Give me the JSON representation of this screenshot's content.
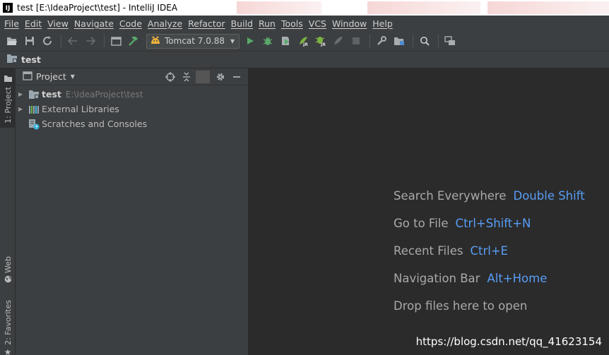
{
  "window": {
    "logo": "IJ",
    "title": "test [E:\\IdeaProject\\test] - IntelliJ IDEA"
  },
  "menu": [
    "File",
    "Edit",
    "View",
    "Navigate",
    "Code",
    "Analyze",
    "Refactor",
    "Build",
    "Run",
    "Tools",
    "VCS",
    "Window",
    "Help"
  ],
  "toolbar": {
    "icons": [
      "open-folder-icon",
      "save-icon",
      "sync-icon",
      "back-arrow-icon",
      "forward-arrow-icon",
      "project-structure-icon",
      "build-hammer-icon"
    ],
    "run_config_label": "Tomcat 7.0.88",
    "run_icons": [
      "run-icon",
      "debug-icon",
      "coverage-icon",
      "jrebel-run-icon",
      "jrebel-debug-icon",
      "profile-icon",
      "stop-icon"
    ],
    "right_icons": [
      "settings-wrench-icon",
      "project-structure-icon",
      "search-icon",
      "sdk-manager-icon"
    ]
  },
  "navbar": {
    "crumb": "test"
  },
  "stripe": {
    "tabs": [
      {
        "label": "1: Project",
        "active": true
      },
      {
        "label": "Web",
        "active": false
      },
      {
        "label": "2: Favorites",
        "active": false
      }
    ]
  },
  "project_panel": {
    "title": "Project",
    "tree": [
      {
        "label": "test",
        "path": "E:\\IdeaProject\\test",
        "icon": "module-folder-icon",
        "bold": true
      },
      {
        "label": "External Libraries",
        "path": "",
        "icon": "libraries-icon",
        "bold": false
      },
      {
        "label": "Scratches and Consoles",
        "path": "",
        "icon": "scratches-icon",
        "bold": false
      }
    ]
  },
  "editor": {
    "hints": [
      {
        "label": "Search Everywhere",
        "key": "Double Shift"
      },
      {
        "label": "Go to File",
        "key": "Ctrl+Shift+N"
      },
      {
        "label": "Recent Files",
        "key": "Ctrl+E"
      },
      {
        "label": "Navigation Bar",
        "key": "Alt+Home"
      },
      {
        "label": "Drop files here to open",
        "key": ""
      }
    ],
    "watermark": "https://blog.csdn.net/qq_41623154"
  },
  "colors": {
    "background": "#3c3f41",
    "editor_bg": "#2b2b2b",
    "shortcut_blue": "#589df6",
    "run_green": "#59a869"
  }
}
